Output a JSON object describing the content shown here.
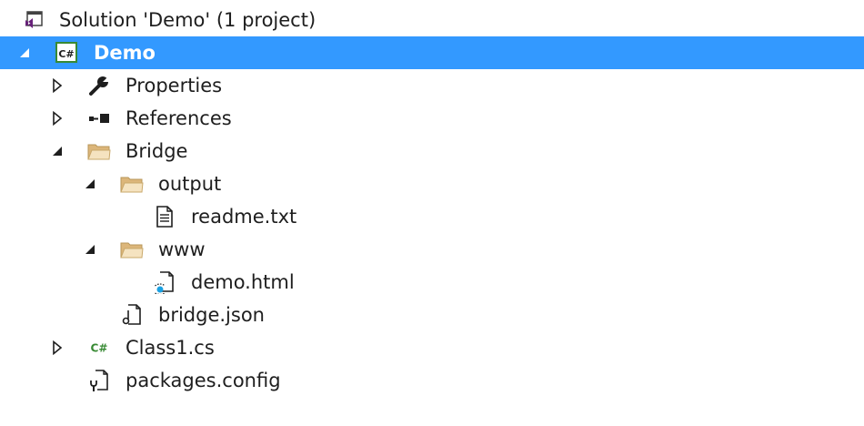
{
  "solution_explorer": {
    "solution_label": "Solution 'Demo' (1 project)",
    "project": {
      "label": "Demo",
      "icon": "csharp-project-icon",
      "badge_text": "C#"
    },
    "nodes": [
      {
        "label": "Properties",
        "icon": "wrench-icon",
        "expanded": false
      },
      {
        "label": "References",
        "icon": "references-icon",
        "expanded": false
      },
      {
        "label": "Bridge",
        "icon": "folder-icon",
        "expanded": true
      },
      {
        "label": "output",
        "icon": "folder-icon",
        "expanded": true
      },
      {
        "label": "readme.txt",
        "icon": "text-file-icon"
      },
      {
        "label": "www",
        "icon": "folder-icon",
        "expanded": true
      },
      {
        "label": "demo.html",
        "icon": "html-file-icon"
      },
      {
        "label": "bridge.json",
        "icon": "json-file-icon"
      },
      {
        "label": "Class1.cs",
        "icon": "csharp-file-icon",
        "expanded": false,
        "badge_text": "C#"
      },
      {
        "label": "packages.config",
        "icon": "config-file-icon"
      }
    ]
  },
  "colors": {
    "selection": "#3399ff",
    "folder": "#dcb67a",
    "csharp": "#388a34",
    "vs_purple": "#68217a",
    "html_blue": "#1ba1e2",
    "text": "#1e1e1e",
    "glyph": "#1e1e1e"
  }
}
